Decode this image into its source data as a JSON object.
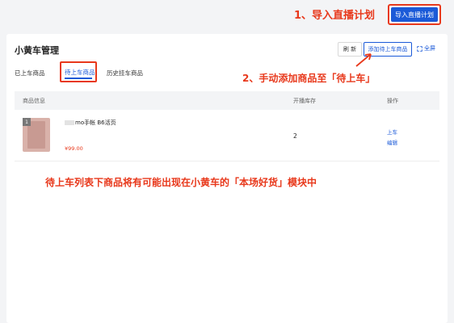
{
  "annotations": {
    "step1": "1、导入直播计划",
    "step2": "2、手动添加商品至「待上车」",
    "note": "待上车列表下商品将有可能出现在小黄车的「本场好货」模块中"
  },
  "header": {
    "import_label": "导入直播计划"
  },
  "panel": {
    "title": "小黄车管理",
    "refresh_label": "刷 新",
    "add_label": "添加待上车商品",
    "fullscreen_label": "全屏",
    "fullscreen_icon": "expand-icon"
  },
  "tabs": [
    {
      "label": "已上车商品",
      "active": false
    },
    {
      "label": "待上车商品",
      "active": true
    },
    {
      "label": "历史挂车商品",
      "active": false
    }
  ],
  "table": {
    "columns": [
      "商品信息",
      "开播库存",
      "操作"
    ],
    "rows": [
      {
        "index": "1",
        "name": "mo手帐 B6活页",
        "price": "¥99.00",
        "stock": "2",
        "actions": [
          "上车",
          "编辑"
        ]
      }
    ]
  },
  "colors": {
    "accent": "#1b5ad8",
    "annotation": "#e8381b"
  }
}
